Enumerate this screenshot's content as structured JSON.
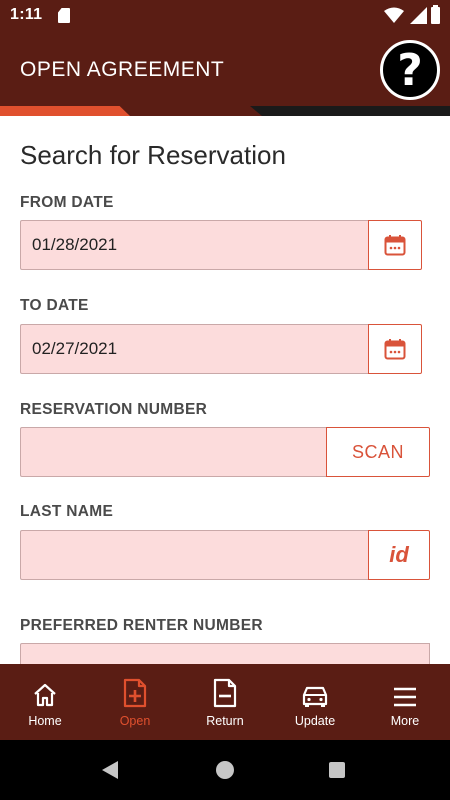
{
  "status_bar": {
    "time": "1:11"
  },
  "header": {
    "title": "OPEN AGREEMENT",
    "help_label": "?"
  },
  "page": {
    "heading": "Search for Reservation"
  },
  "form": {
    "from_date": {
      "label": "FROM DATE",
      "value": "01/28/2021",
      "button_icon": "calendar-icon"
    },
    "to_date": {
      "label": "TO DATE",
      "value": "02/27/2021",
      "button_icon": "calendar-icon"
    },
    "reservation_number": {
      "label": "RESERVATION NUMBER",
      "value": "",
      "button_label": "SCAN"
    },
    "last_name": {
      "label": "LAST NAME",
      "value": "",
      "button_label": "id"
    },
    "preferred_renter_number": {
      "label": "PREFERRED RENTER NUMBER",
      "value": ""
    }
  },
  "bottom_nav": {
    "items": [
      {
        "label": "Home",
        "icon": "home-icon",
        "active": false
      },
      {
        "label": "Open",
        "icon": "document-plus-icon",
        "active": true
      },
      {
        "label": "Return",
        "icon": "document-minus-icon",
        "active": false
      },
      {
        "label": "Update",
        "icon": "car-icon",
        "active": false
      },
      {
        "label": "More",
        "icon": "menu-icon",
        "active": false
      }
    ]
  },
  "colors": {
    "brand_dark": "#5a1d14",
    "accent": "#e0502e",
    "input_bg": "#fcdcdc",
    "button_border": "#d9533a"
  }
}
